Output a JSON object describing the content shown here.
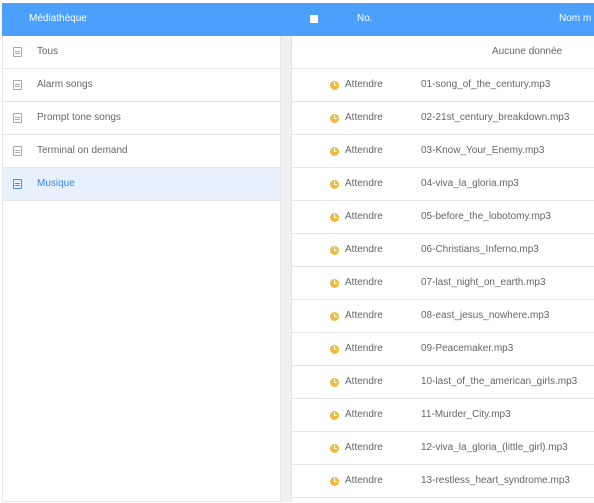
{
  "header": {
    "title": "Médiathèque",
    "col_no": "No.",
    "col_name": "Nom m"
  },
  "sidebar": {
    "items": [
      {
        "label": "Tous",
        "icon": "document-icon",
        "active": false
      },
      {
        "label": "Alarm songs",
        "icon": "document-icon",
        "active": false
      },
      {
        "label": "Prompt tone songs",
        "icon": "document-icon",
        "active": false
      },
      {
        "label": "Terminal on demand",
        "icon": "document-icon",
        "active": false
      },
      {
        "label": "Musique",
        "icon": "document-icon",
        "active": true
      }
    ]
  },
  "main": {
    "empty_text": "Aucune donnée",
    "rows": [
      {
        "status": "Attendre",
        "file": "01-song_of_the_century.mp3"
      },
      {
        "status": "Attendre",
        "file": "02-21st_century_breakdown.mp3"
      },
      {
        "status": "Attendre",
        "file": "03-Know_Your_Enemy.mp3"
      },
      {
        "status": "Attendre",
        "file": "04-viva_la_gloria.mp3"
      },
      {
        "status": "Attendre",
        "file": "05-before_the_lobotomy.mp3"
      },
      {
        "status": "Attendre",
        "file": "06-Christians_Inferno.mp3"
      },
      {
        "status": "Attendre",
        "file": "07-last_night_on_earth.mp3"
      },
      {
        "status": "Attendre",
        "file": "08-east_jesus_nowhere.mp3"
      },
      {
        "status": "Attendre",
        "file": "09-Peacemaker.mp3"
      },
      {
        "status": "Attendre",
        "file": "10-last_of_the_american_girls.mp3"
      },
      {
        "status": "Attendre",
        "file": "11-Murder_City.mp3"
      },
      {
        "status": "Attendre",
        "file": "12-viva_la_gloria_(little_girl).mp3"
      },
      {
        "status": "Attendre",
        "file": "13-restless_heart_syndrome.mp3"
      }
    ]
  },
  "colors": {
    "header_bg": "#4aa0fb",
    "active_bg": "#e6f1fd",
    "active_text": "#3a86e0",
    "status_icon": "#f2b93b"
  }
}
